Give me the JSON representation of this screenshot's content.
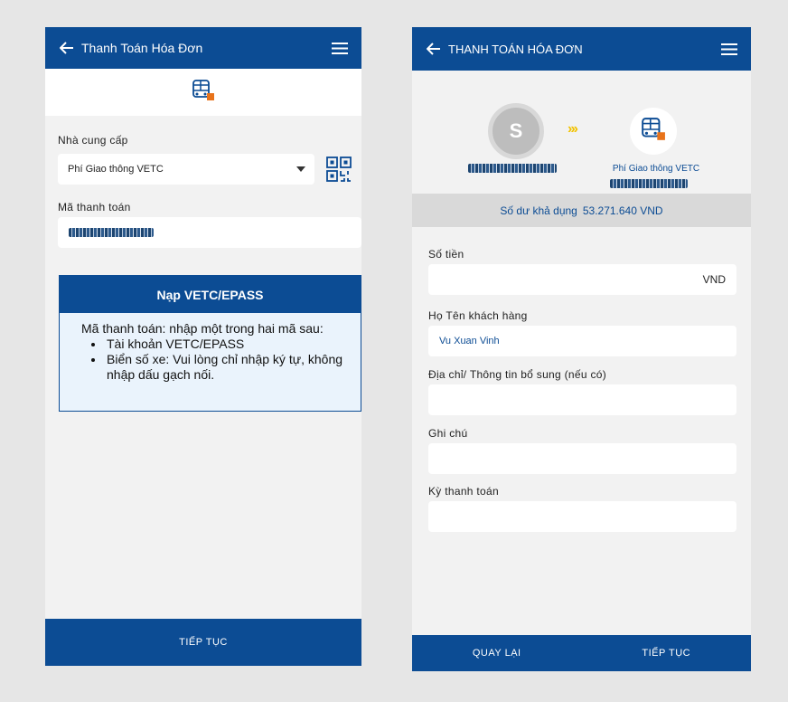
{
  "left_screen": {
    "header": {
      "title": "Thanh Toán Hóa Đơn"
    },
    "provider": {
      "label": "Nhà cung cấp",
      "selected": "Phí Giao thông VETC"
    },
    "payment_code": {
      "label": "Mã thanh toán"
    },
    "info_card": {
      "title": "Nạp VETC/EPASS",
      "intro": "Mã thanh toán: nhập một trong hai mã sau:",
      "items": [
        "Tài khoản VETC/EPASS",
        "Biển số xe: Vui lòng chỉ nhập ký tự, không nhập dấu gạch nối."
      ]
    },
    "footer": {
      "continue_label": "TIẾP TỤC"
    }
  },
  "right_screen": {
    "header": {
      "title": "THANH TOÁN HÓA ĐƠN"
    },
    "avatar_letter": "S",
    "biller_name": "Phí Giao thông VETC",
    "balance": {
      "label": "Số dư khả dụng",
      "value": "53.271.640 VND"
    },
    "amount": {
      "label": "Số tiền",
      "currency": "VND"
    },
    "customer_name": {
      "label": "Họ Tên khách hàng",
      "value": "Vu Xuan Vinh"
    },
    "address": {
      "label": "Địa chỉ/ Thông tin bổ sung (nếu có)"
    },
    "note": {
      "label": "Ghi chú"
    },
    "period": {
      "label": "Kỳ thanh toán"
    },
    "footer": {
      "back_label": "QUAY LẠI",
      "continue_label": "TIẾP TỤC"
    }
  },
  "colors": {
    "primary": "#0c4c94",
    "accent": "#e8731a",
    "chevron": "#f2c200"
  },
  "icons": [
    "back-arrow-icon",
    "menu-icon",
    "bus-icon",
    "qr-code-icon",
    "dropdown-caret-icon"
  ]
}
